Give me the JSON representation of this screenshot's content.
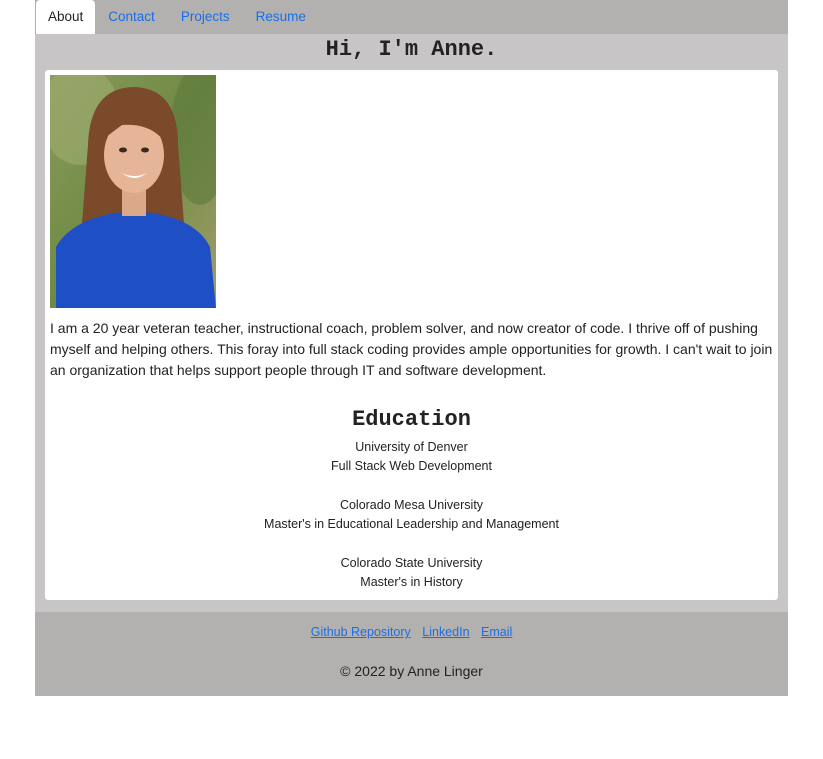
{
  "nav": {
    "tabs": [
      {
        "label": "About",
        "active": true
      },
      {
        "label": "Contact",
        "active": false
      },
      {
        "label": "Projects",
        "active": false
      },
      {
        "label": "Resume",
        "active": false
      }
    ]
  },
  "header": {
    "title": "Hi, I'm Anne."
  },
  "about": {
    "bio": "I am a 20 year veteran teacher, instructional coach, problem solver, and now creator of code. I thrive off of pushing myself and helping others. This foray into full stack coding provides ample opportunities for growth. I can't wait to join an organization that helps support people through IT and software development."
  },
  "education": {
    "title": "Education",
    "schools": [
      {
        "name": "University of Denver",
        "program": "Full Stack Web Development"
      },
      {
        "name": "Colorado Mesa University",
        "program": "Master's in Educational Leadership and Management"
      },
      {
        "name": "Colorado State University",
        "program": "Master's in History"
      }
    ]
  },
  "footer": {
    "links": [
      "Github Repository",
      "LinkedIn",
      "Email"
    ],
    "copyright": "© 2022 by Anne Linger"
  },
  "colors": {
    "link": "#1a6fe8",
    "nav_background": "#b3b0b0",
    "main_background": "#c7c5c5"
  }
}
